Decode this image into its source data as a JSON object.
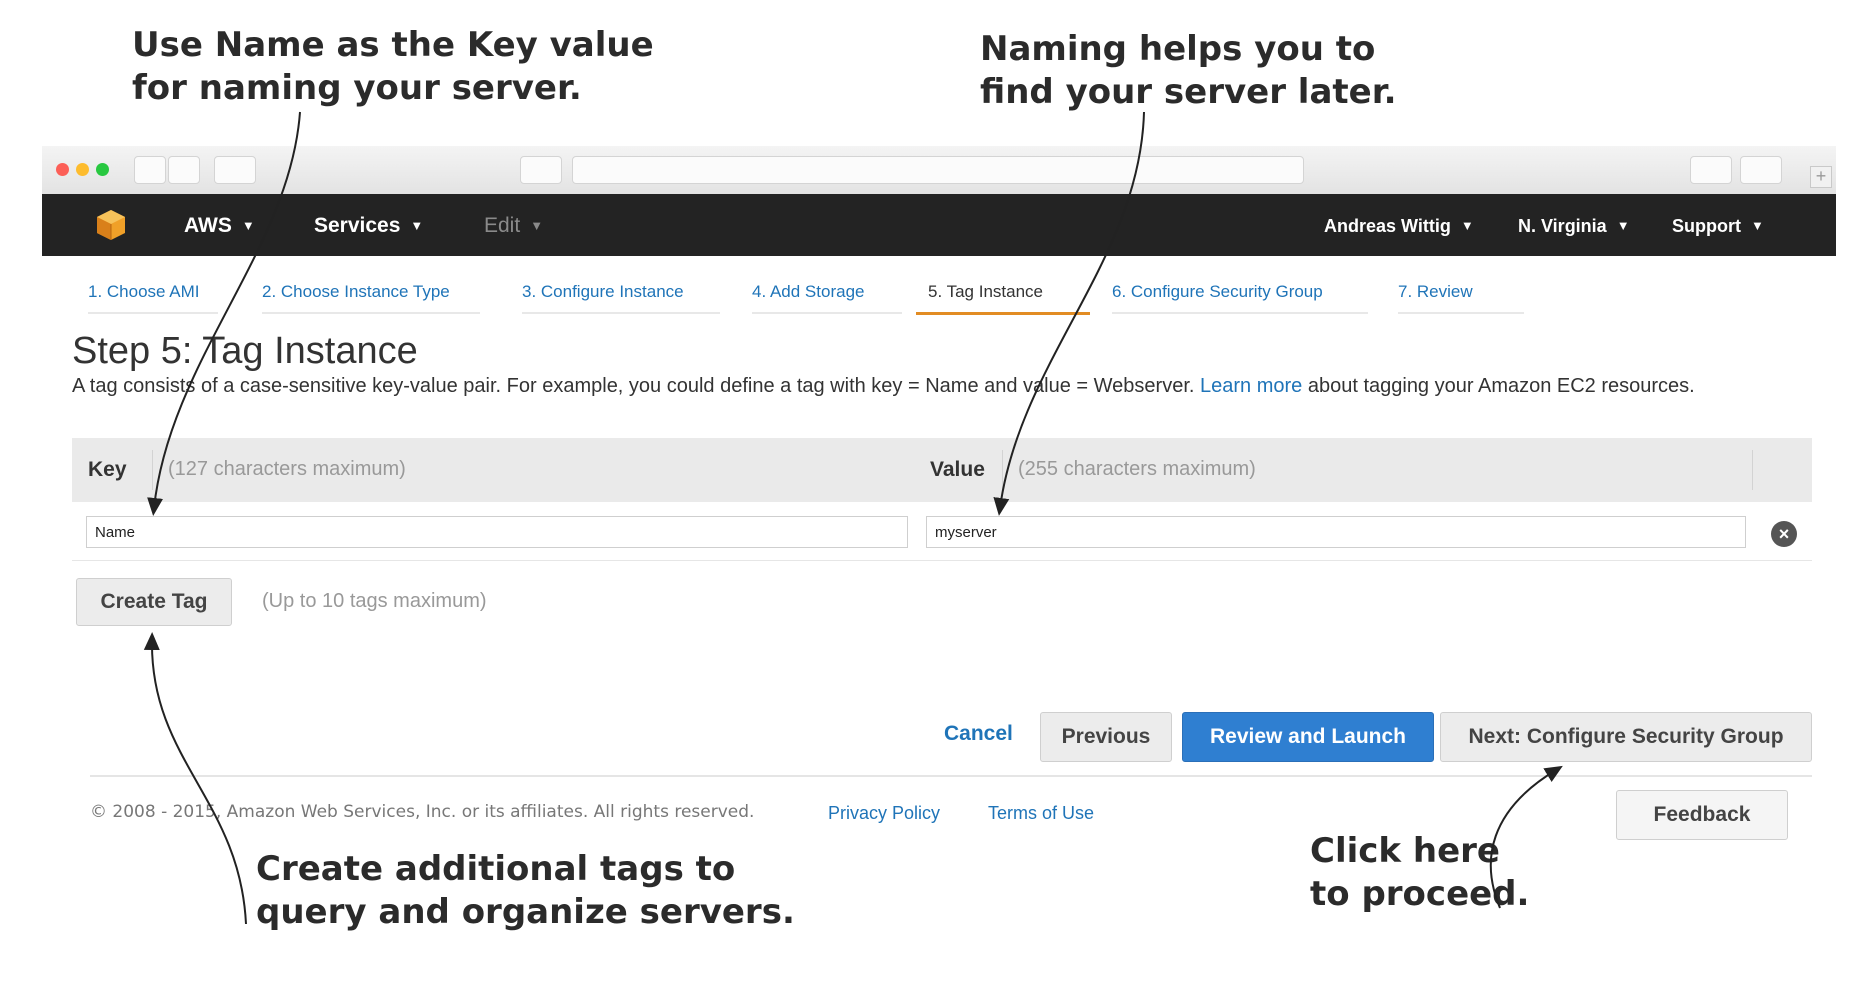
{
  "annotations": {
    "top_left": "Use Name as the Key value\nfor naming your server.",
    "top_right": "Naming helps you to\nfind your server later.",
    "bottom_left": "Create additional tags to\nquery and organize servers.",
    "bottom_right": "Click here\nto proceed."
  },
  "navbar": {
    "brand": "AWS",
    "services": "Services",
    "edit": "Edit",
    "user": "Andreas Wittig",
    "region": "N. Virginia",
    "support": "Support",
    "colors": {
      "background": "#232323",
      "logo": "#f0a028"
    }
  },
  "steps": [
    {
      "label": "1. Choose AMI"
    },
    {
      "label": "2. Choose Instance Type"
    },
    {
      "label": "3. Configure Instance"
    },
    {
      "label": "4. Add Storage"
    },
    {
      "label": "5. Tag Instance",
      "active": true
    },
    {
      "label": "6. Configure Security Group"
    },
    {
      "label": "7. Review"
    }
  ],
  "page": {
    "title": "Step 5: Tag Instance",
    "description_before": "A tag consists of a case-sensitive key-value pair. For example, you could define a tag with key = Name and value = Webserver. ",
    "learn_more": "Learn more",
    "description_after": " about tagging your Amazon EC2 resources."
  },
  "table": {
    "key_header": "Key",
    "key_hint": "(127 characters maximum)",
    "value_header": "Value",
    "value_hint": "(255 characters maximum)",
    "row": {
      "key": "Name",
      "value": "myserver"
    }
  },
  "create_tag": {
    "label": "Create Tag",
    "hint": "(Up to 10 tags maximum)"
  },
  "actions": {
    "cancel": "Cancel",
    "previous": "Previous",
    "review_launch": "Review and Launch",
    "next": "Next: Configure Security Group",
    "primary_color": "#2f7fd1"
  },
  "footer": {
    "copyright": "© 2008 - 2015, Amazon Web Services, Inc. or its affiliates. All rights reserved.",
    "privacy": "Privacy Policy",
    "terms": "Terms of Use",
    "feedback": "Feedback"
  }
}
